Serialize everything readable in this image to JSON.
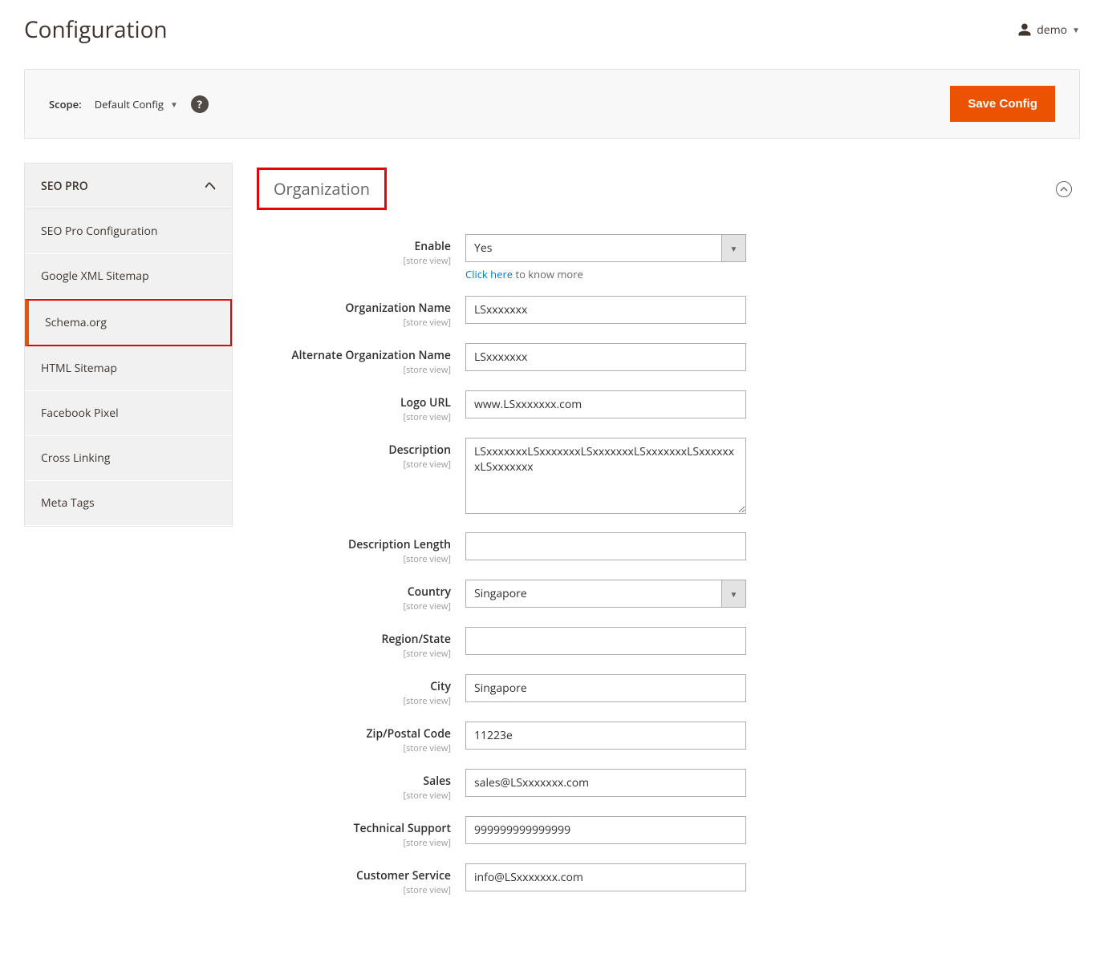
{
  "header": {
    "title": "Configuration",
    "user_name": "demo"
  },
  "toolbar": {
    "scope_label": "Scope:",
    "scope_value": "Default Config",
    "save_label": "Save Config"
  },
  "sidebar": {
    "section_title": "SEO PRO",
    "items": [
      {
        "label": "SEO Pro Configuration"
      },
      {
        "label": "Google XML Sitemap"
      },
      {
        "label": "Schema.org"
      },
      {
        "label": "HTML Sitemap"
      },
      {
        "label": "Facebook Pixel"
      },
      {
        "label": "Cross Linking"
      },
      {
        "label": "Meta Tags"
      }
    ]
  },
  "section": {
    "title": "Organization",
    "scope_text": "[store view]",
    "helper_link": "Click here",
    "helper_text": " to know more",
    "fields": {
      "enable": {
        "label": "Enable",
        "value": "Yes"
      },
      "org_name": {
        "label": "Organization Name",
        "value": "LSxxxxxxx"
      },
      "alt_org_name": {
        "label": "Alternate Organization Name",
        "value": "LSxxxxxxx"
      },
      "logo_url": {
        "label": "Logo URL",
        "value": "www.LSxxxxxxx.com"
      },
      "description": {
        "label": "Description",
        "value": "LSxxxxxxxLSxxxxxxxLSxxxxxxxLSxxxxxxxLSxxxxxxxLSxxxxxxx"
      },
      "desc_length": {
        "label": "Description Length",
        "value": ""
      },
      "country": {
        "label": "Country",
        "value": "Singapore"
      },
      "region": {
        "label": "Region/State",
        "value": ""
      },
      "city": {
        "label": "City",
        "value": "Singapore"
      },
      "zip": {
        "label": "Zip/Postal Code",
        "value": "11223e"
      },
      "sales": {
        "label": "Sales",
        "value": "sales@LSxxxxxxx.com"
      },
      "tech": {
        "label": "Technical Support",
        "value": "999999999999999"
      },
      "cust": {
        "label": "Customer Service",
        "value": "info@LSxxxxxxx.com"
      }
    }
  }
}
